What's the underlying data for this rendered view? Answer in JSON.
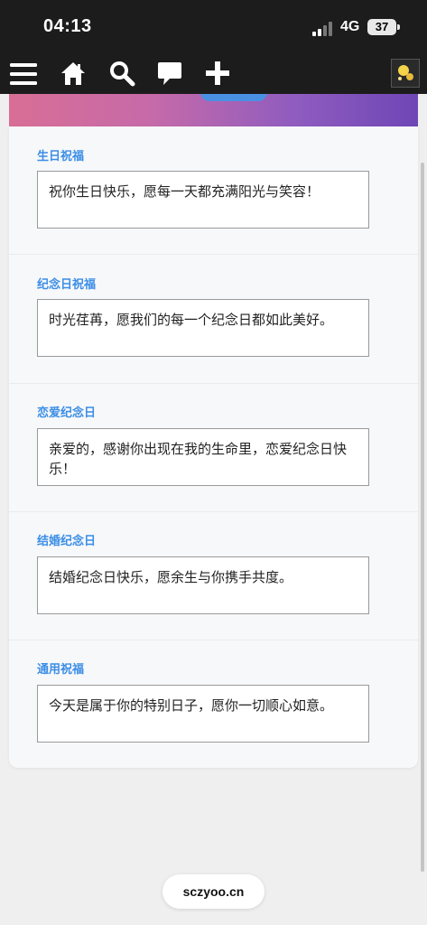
{
  "status_bar": {
    "time": "04:13",
    "network": "4G",
    "battery": "37"
  },
  "nav": {
    "icons": [
      "menu-icon",
      "home-icon",
      "search-icon",
      "comment-icon",
      "plus-icon",
      "avatar"
    ]
  },
  "sections": [
    {
      "title": "生日祝福",
      "message": "祝你生日快乐，愿每一天都充满阳光与笑容！"
    },
    {
      "title": "纪念日祝福",
      "message": "时光荏苒，愿我们的每一个纪念日都如此美好。"
    },
    {
      "title": "恋爱纪念日",
      "message": "亲爱的，感谢你出现在我的生命里，恋爱纪念日快乐！"
    },
    {
      "title": "结婚纪念日",
      "message": "结婚纪念日快乐，愿余生与你携手共度。"
    },
    {
      "title": "通用祝福",
      "message": "今天是属于你的特别日子，愿你一切顺心如意。"
    }
  ],
  "browser": {
    "url": "sczyoo.cn"
  },
  "colors": {
    "accent": "#3b8ee6",
    "topbar": "#1c1c1c"
  }
}
